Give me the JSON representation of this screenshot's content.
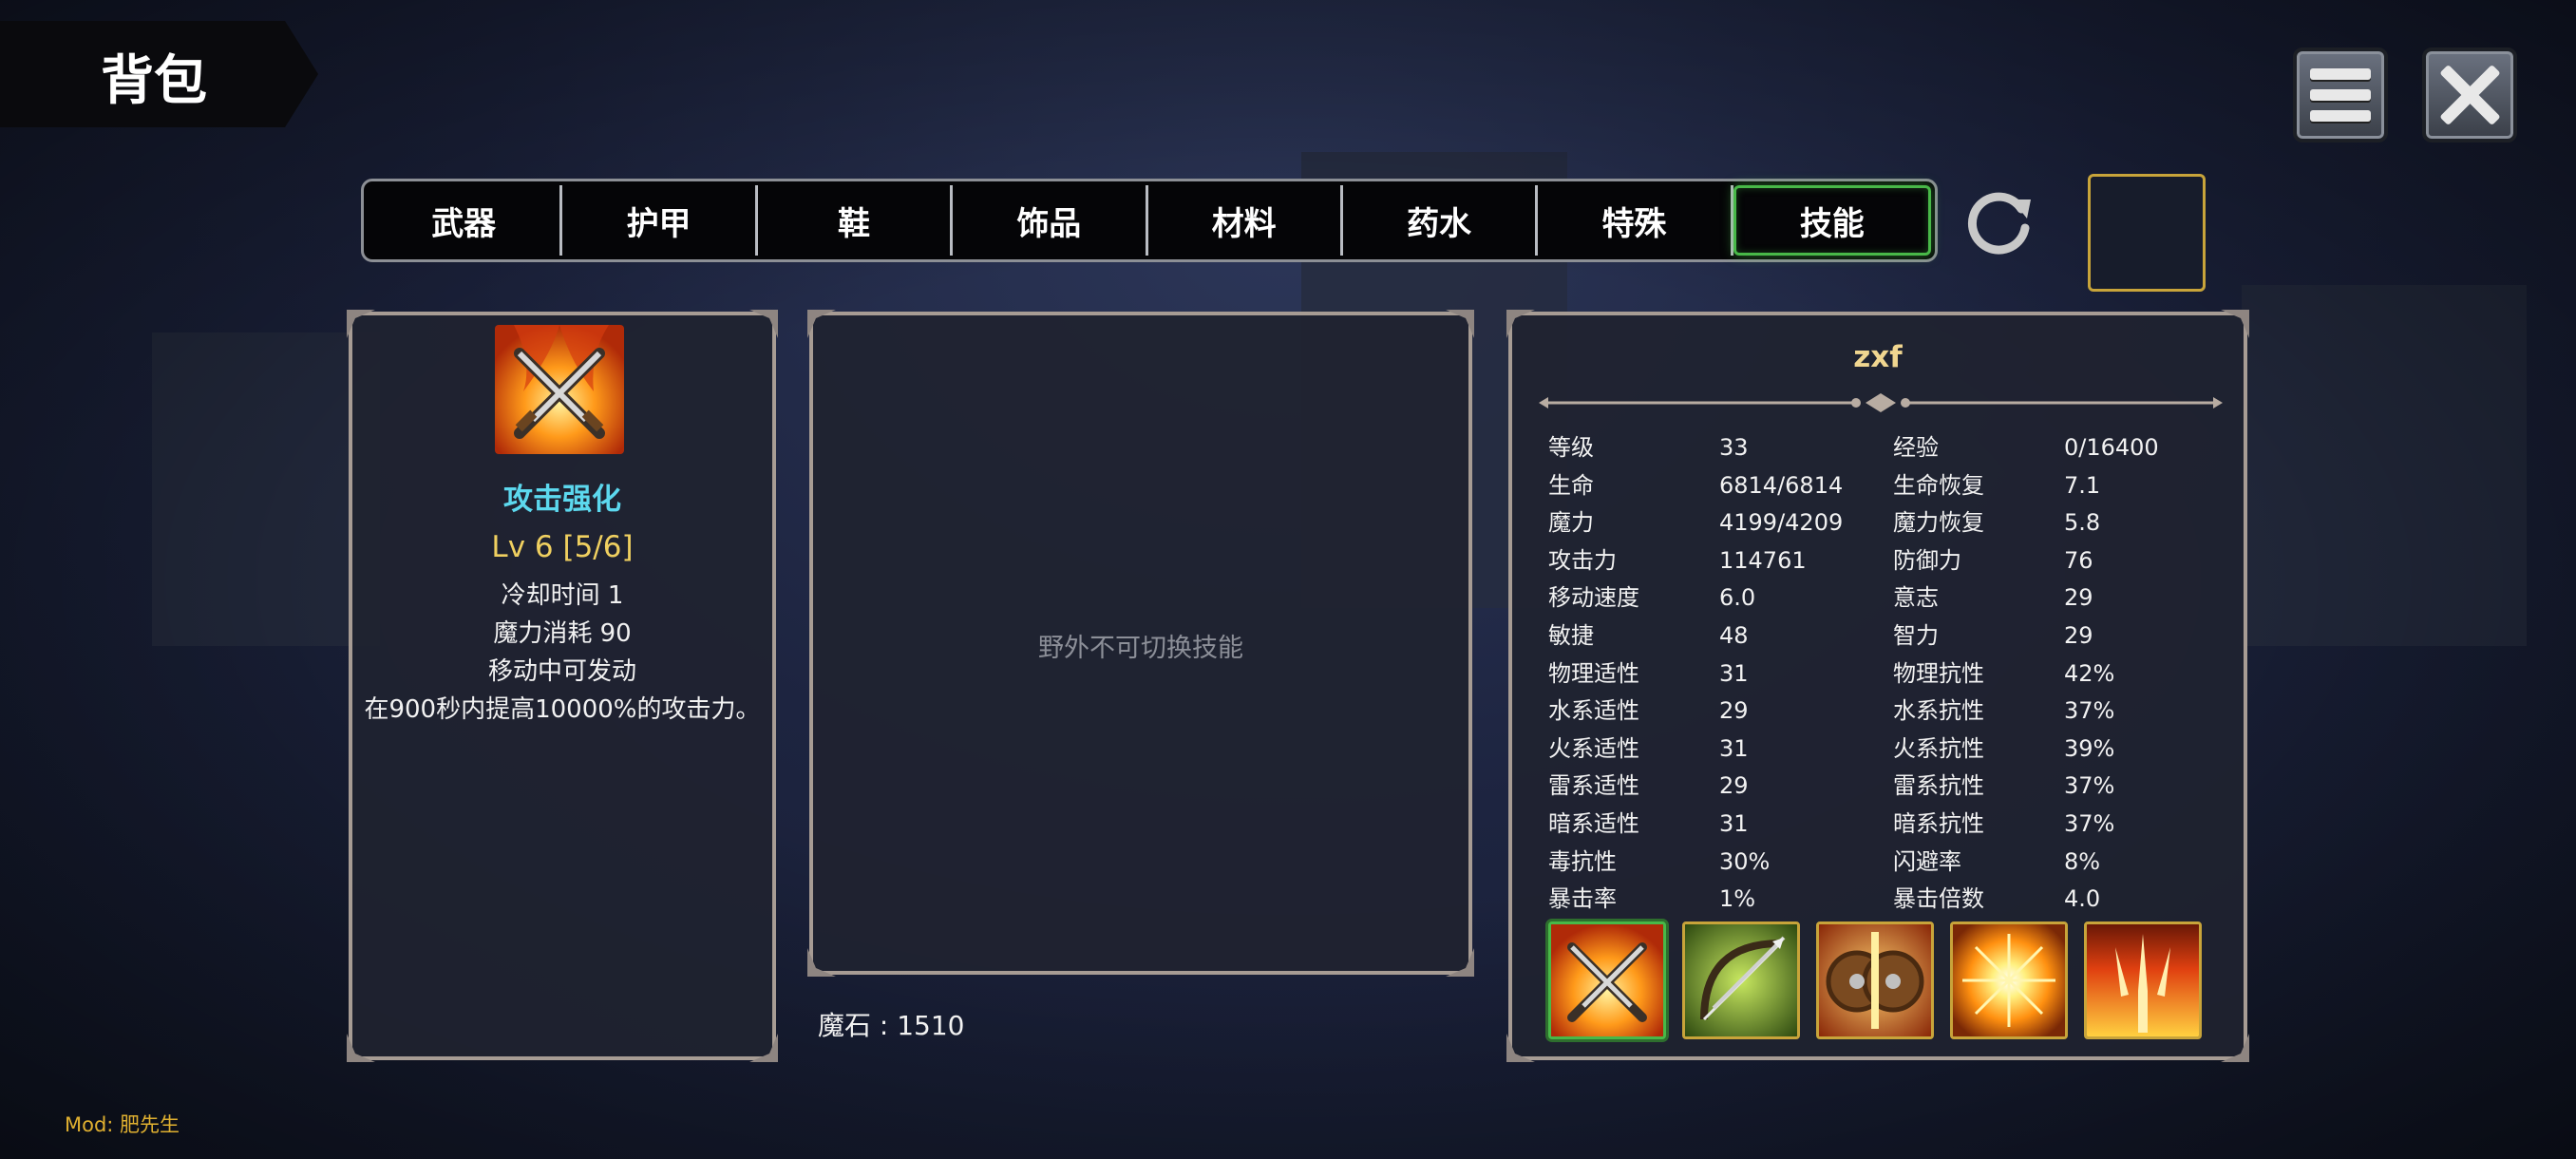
{
  "header": {
    "title": "背包"
  },
  "tabs": [
    {
      "label": "武器"
    },
    {
      "label": "护甲"
    },
    {
      "label": "鞋"
    },
    {
      "label": "饰品"
    },
    {
      "label": "材料"
    },
    {
      "label": "药水"
    },
    {
      "label": "特殊"
    },
    {
      "label": "技能",
      "active": true
    }
  ],
  "skill_detail": {
    "name": "攻击强化",
    "level": "Lv 6 [5/6]",
    "cooldown": "冷却时间 1",
    "mana_cost": "魔力消耗 90",
    "note": "移动中可发动",
    "description": "在900秒内提高10000%的攻击力。"
  },
  "center": {
    "message": "野外不可切换技能",
    "magic_stone": "魔石 : 1510"
  },
  "character": {
    "name": "zxf",
    "stats": [
      [
        "等级",
        "33",
        "经验",
        "0/16400"
      ],
      [
        "生命",
        "6814/6814",
        "生命恢复",
        "7.1"
      ],
      [
        "魔力",
        "4199/4209",
        "魔力恢复",
        "5.8"
      ],
      [
        "攻击力",
        "114761",
        "防御力",
        "76"
      ],
      [
        "移动速度",
        "6.0",
        "意志",
        "29"
      ],
      [
        "敏捷",
        "48",
        "智力",
        "29"
      ],
      [
        "物理适性",
        "31",
        "物理抗性",
        "42%"
      ],
      [
        "水系适性",
        "29",
        "水系抗性",
        "37%"
      ],
      [
        "火系适性",
        "31",
        "火系抗性",
        "39%"
      ],
      [
        "雷系适性",
        "29",
        "雷系抗性",
        "37%"
      ],
      [
        "暗系适性",
        "31",
        "暗系抗性",
        "37%"
      ],
      [
        "毒抗性",
        "30%",
        "闪避率",
        "8%"
      ],
      [
        "暴击率",
        "1%",
        "暴击倍数",
        "4.0"
      ]
    ],
    "skill_slots": [
      {
        "icon": "crossed-swords-fire-icon",
        "selected": true
      },
      {
        "icon": "bow-icon",
        "selected": false
      },
      {
        "icon": "shield-icon",
        "selected": false
      },
      {
        "icon": "sunburst-icon",
        "selected": false
      },
      {
        "icon": "trident-fire-icon",
        "selected": false
      }
    ]
  },
  "footer": {
    "mod": "Mod: 肥先生"
  },
  "colors": {
    "skill_name": "#5cd8ee",
    "skill_level": "#f0d060",
    "char_name": "#f0d690",
    "active_tab": "#48b848",
    "slot_border": "#c8a43a"
  }
}
